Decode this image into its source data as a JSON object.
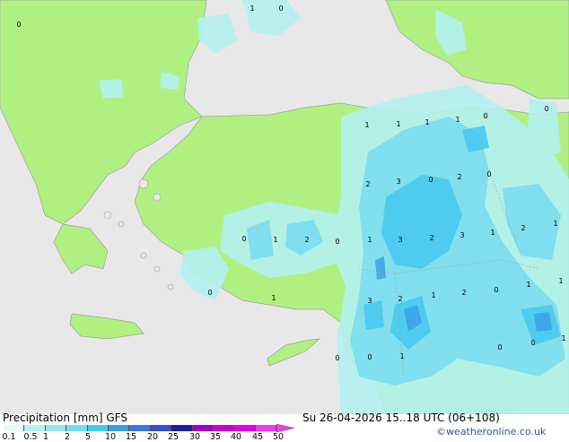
{
  "map": {
    "values": [
      {
        "t": "1"
      },
      {
        "t": "0"
      },
      {
        "t": "0"
      },
      {
        "t": "0"
      },
      {
        "t": "1"
      },
      {
        "t": "1"
      },
      {
        "t": "1"
      },
      {
        "t": "1"
      },
      {
        "t": "0"
      },
      {
        "t": "2"
      },
      {
        "t": "3"
      },
      {
        "t": "0"
      },
      {
        "t": "2"
      },
      {
        "t": "0"
      },
      {
        "t": "0"
      },
      {
        "t": "1"
      },
      {
        "t": "2"
      },
      {
        "t": "0"
      },
      {
        "t": "1"
      },
      {
        "t": "3"
      },
      {
        "t": "2"
      },
      {
        "t": "3"
      },
      {
        "t": "1"
      },
      {
        "t": "2"
      },
      {
        "t": "1"
      },
      {
        "t": "0"
      },
      {
        "t": "1"
      },
      {
        "t": "3"
      },
      {
        "t": "2"
      },
      {
        "t": "1"
      },
      {
        "t": "2"
      },
      {
        "t": "0"
      },
      {
        "t": "1"
      },
      {
        "t": "1"
      },
      {
        "t": "0"
      },
      {
        "t": "0"
      },
      {
        "t": "1"
      },
      {
        "t": "0"
      },
      {
        "t": "0"
      },
      {
        "t": "1"
      }
    ]
  },
  "footer": {
    "title": "Precipitation [mm]  GFS",
    "datetime": "Su 26-04-2026 15..18 UTC (06+108)",
    "credit": "©weatheronline.co.uk",
    "legend_ticks": [
      "0.1",
      "0.5",
      "1",
      "2",
      "5",
      "10",
      "15",
      "20",
      "25",
      "30",
      "35",
      "40",
      "45",
      "50"
    ],
    "legend_colors": [
      "#e6fafa",
      "#b4f0f0",
      "#96e6f0",
      "#78dcf0",
      "#46c8f0",
      "#3c9ee6",
      "#3c78dc",
      "#3250c8",
      "#1e1e9a",
      "#a000c8",
      "#c800c8",
      "#e600e6",
      "#f03cf0"
    ]
  },
  "colors": {
    "sea": "#e8e8e8",
    "land": "#b0f080",
    "coast": "#a0a0a0"
  }
}
